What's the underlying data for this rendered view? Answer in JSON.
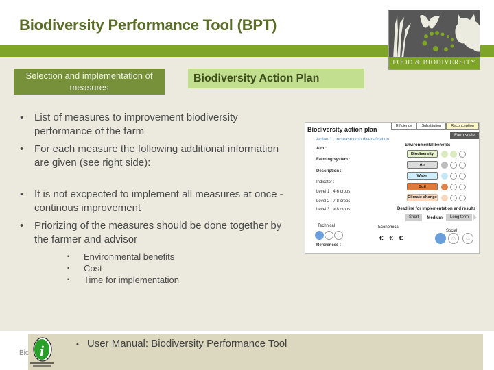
{
  "header": {
    "title": "Biodiversity Performance Tool (BPT)",
    "logo_caption": "FOOD & BIODIVERSITY",
    "logo_icon": "food-biodiversity-logo"
  },
  "section_buttons": {
    "selection_label": "Selection and implementation of measures",
    "action_plan_label": "Biodiversity Action Plan"
  },
  "bullets": [
    "List of measures to improvement biodiversity performance of the farm",
    "For each measure the following additional information are given (see right side):",
    "It is not excpected to implement all measures at once  - continous improvement",
    "Priorizing of the measures should be done together by the farmer and advisor"
  ],
  "sub_bullets": [
    "Environmental benefits",
    "Cost",
    "Time for implementation"
  ],
  "bullet_glyph": "•",
  "sub_bullet_glyph": "▪",
  "screenshot": {
    "title": "Biodiversity action plan",
    "tabs": [
      {
        "label": "Efficiency",
        "active": false
      },
      {
        "label": "Substitution",
        "active": false
      },
      {
        "label": "Reconception",
        "active": true
      }
    ],
    "farm_scale": "Farm scale",
    "action": "Action 1 : Increase crop diversification",
    "labels": {
      "aim": "Aim :",
      "farming_system": "Farming system :",
      "description": "Description :",
      "indicator": "Indicator :",
      "level1": "Level 1 : 4-6 crops",
      "level2": "Level 2 : 7-8 crops",
      "level3": "Level 3 : > 8 crops",
      "references": "References :"
    },
    "env_benefits_title": "Environmental benefits",
    "env_benefits": [
      {
        "label": "Biodiversity",
        "color": "#e6f2cc",
        "filled": 2,
        "circle_color": "#dcebbf"
      },
      {
        "label": "Air",
        "color": "#dcdcdc",
        "filled": 1,
        "circle_color": "#bdbdbd"
      },
      {
        "label": "Water",
        "color": "#cdeefa",
        "filled": 1,
        "circle_color": "#c6e7f5"
      },
      {
        "label": "Soil",
        "color": "#e07a3c",
        "filled": 1,
        "circle_color": "#e0834a"
      },
      {
        "label": "Climate change",
        "color": "#fbd8bf",
        "filled": 1,
        "circle_color": "#f8d6bc"
      }
    ],
    "deadline_title": "Deadline for implementation and results",
    "deadline_options": [
      {
        "label": "Short",
        "active": false
      },
      {
        "label": "Medium",
        "active": true
      },
      {
        "label": "Long term",
        "active": false
      }
    ],
    "technical_label": "Technical",
    "technical_rating": 1,
    "economical_label": "Economical",
    "economical_value": "€ € €",
    "social_label": "Social",
    "social_rating": 1
  },
  "footer": {
    "left_text": "Bio",
    "manual_text": "User Manual: Biodiversity Performance Tool",
    "info_icon": "info-icon"
  },
  "colors": {
    "title": "#5a6e2a",
    "green_bar": "#7ea528",
    "selection_button": "#77913a",
    "action_plan_button": "#c2df8f",
    "content_bg": "#ece9de",
    "footer_box": "#dcd7bf"
  }
}
